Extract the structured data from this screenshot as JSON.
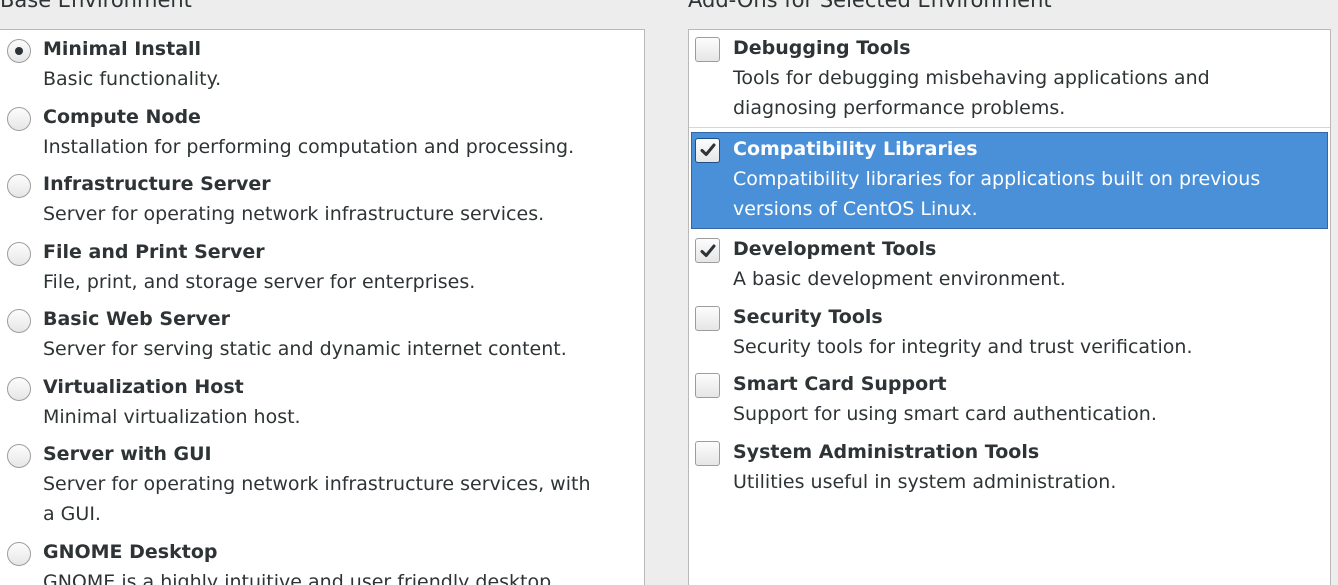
{
  "base_environment": {
    "heading": "Base Environment",
    "items": [
      {
        "title": "Minimal Install",
        "desc": "Basic functionality.",
        "selected": true
      },
      {
        "title": "Compute Node",
        "desc": "Installation for performing computation and processing.",
        "selected": false
      },
      {
        "title": "Infrastructure Server",
        "desc": "Server for operating network infrastructure services.",
        "selected": false
      },
      {
        "title": "File and Print Server",
        "desc": "File, print, and storage server for enterprises.",
        "selected": false
      },
      {
        "title": "Basic Web Server",
        "desc": "Server for serving static and dynamic internet content.",
        "selected": false
      },
      {
        "title": "Virtualization Host",
        "desc": "Minimal virtualization host.",
        "selected": false
      },
      {
        "title": "Server with GUI",
        "desc": "Server for operating network infrastructure services, with a GUI.",
        "selected": false
      },
      {
        "title": "GNOME Desktop",
        "desc": "GNOME is a highly intuitive and user friendly desktop",
        "selected": false
      }
    ]
  },
  "addons": {
    "heading": "Add-Ons for Selected Environment",
    "items": [
      {
        "title": "Debugging Tools",
        "desc": "Tools for debugging misbehaving applications and diagnosing performance problems.",
        "checked": false
      },
      {
        "title": "Compatibility Libraries",
        "desc": "Compatibility libraries for applications built on previous versions of CentOS Linux.",
        "checked": true
      },
      {
        "title": "Development Tools",
        "desc": "A basic development environment.",
        "checked": true
      },
      {
        "title": "Security Tools",
        "desc": "Security tools for integrity and trust verification.",
        "checked": false
      },
      {
        "title": "Smart Card Support",
        "desc": "Support for using smart card authentication.",
        "checked": false
      },
      {
        "title": "System Administration Tools",
        "desc": "Utilities useful in system administration.",
        "checked": false
      }
    ]
  },
  "colors": {
    "selection_bg": "#4a90d9",
    "selection_border": "#3465a4",
    "text": "#2e3436",
    "background": "#ededed"
  }
}
